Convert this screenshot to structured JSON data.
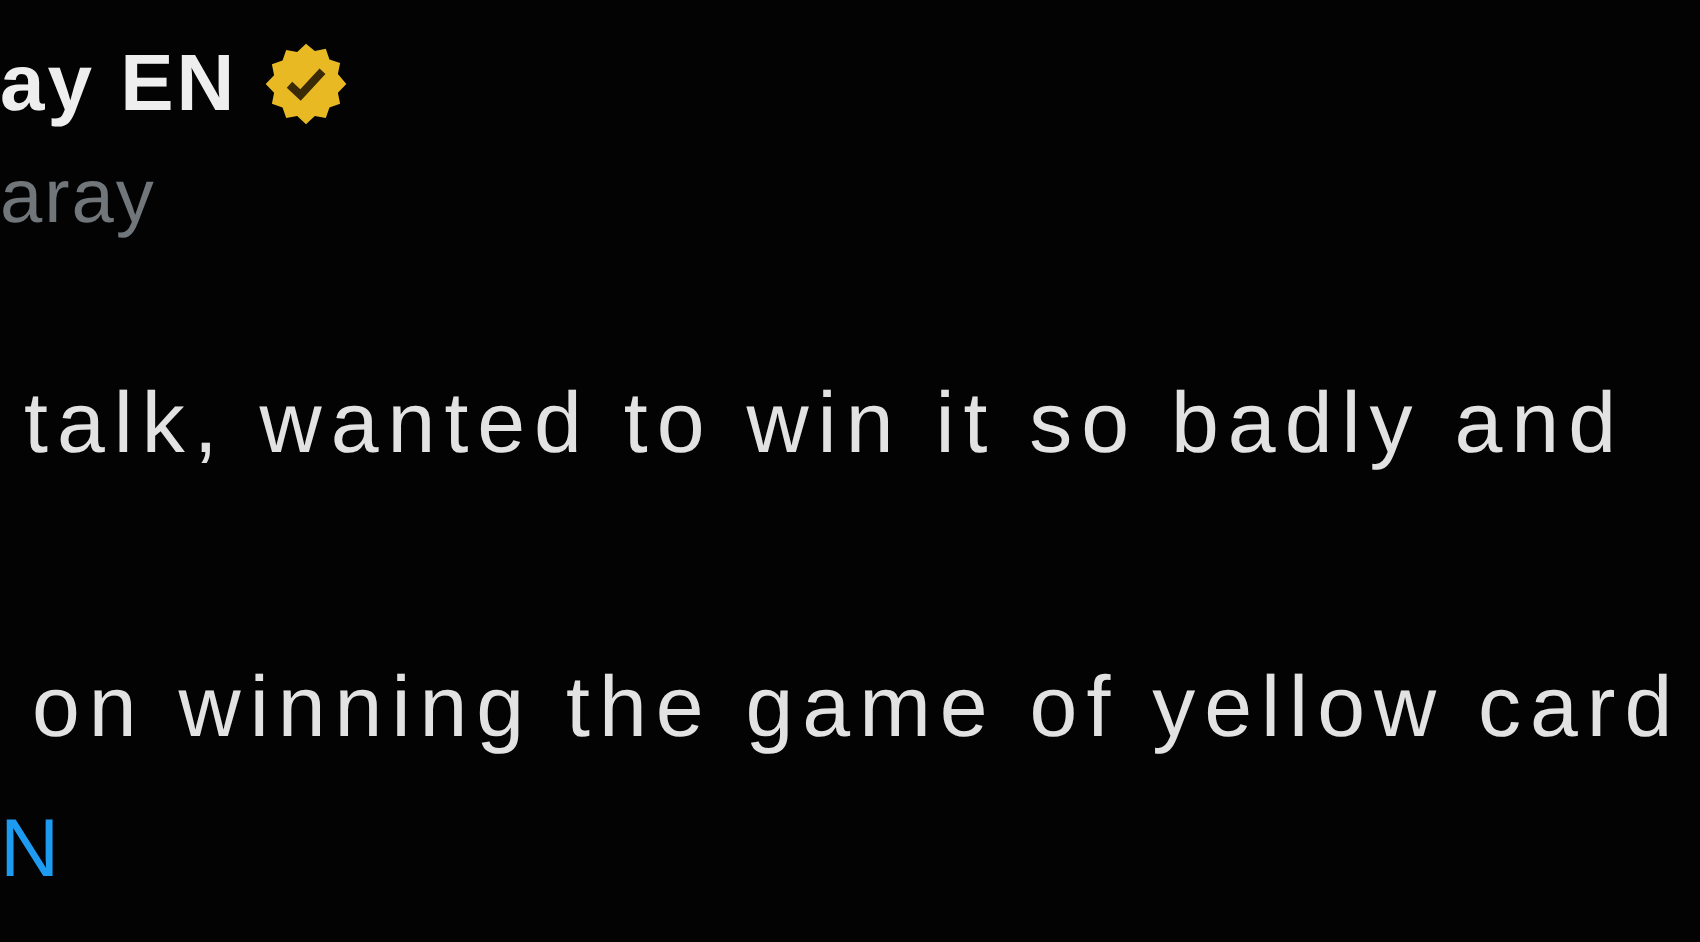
{
  "author": {
    "name": "ay EN",
    "verified": true,
    "handle": "aray"
  },
  "body": {
    "lines": [
      "talk, wanted to win it so badly and",
      "on winning the game of yellow card"
    ],
    "link": "N"
  }
}
